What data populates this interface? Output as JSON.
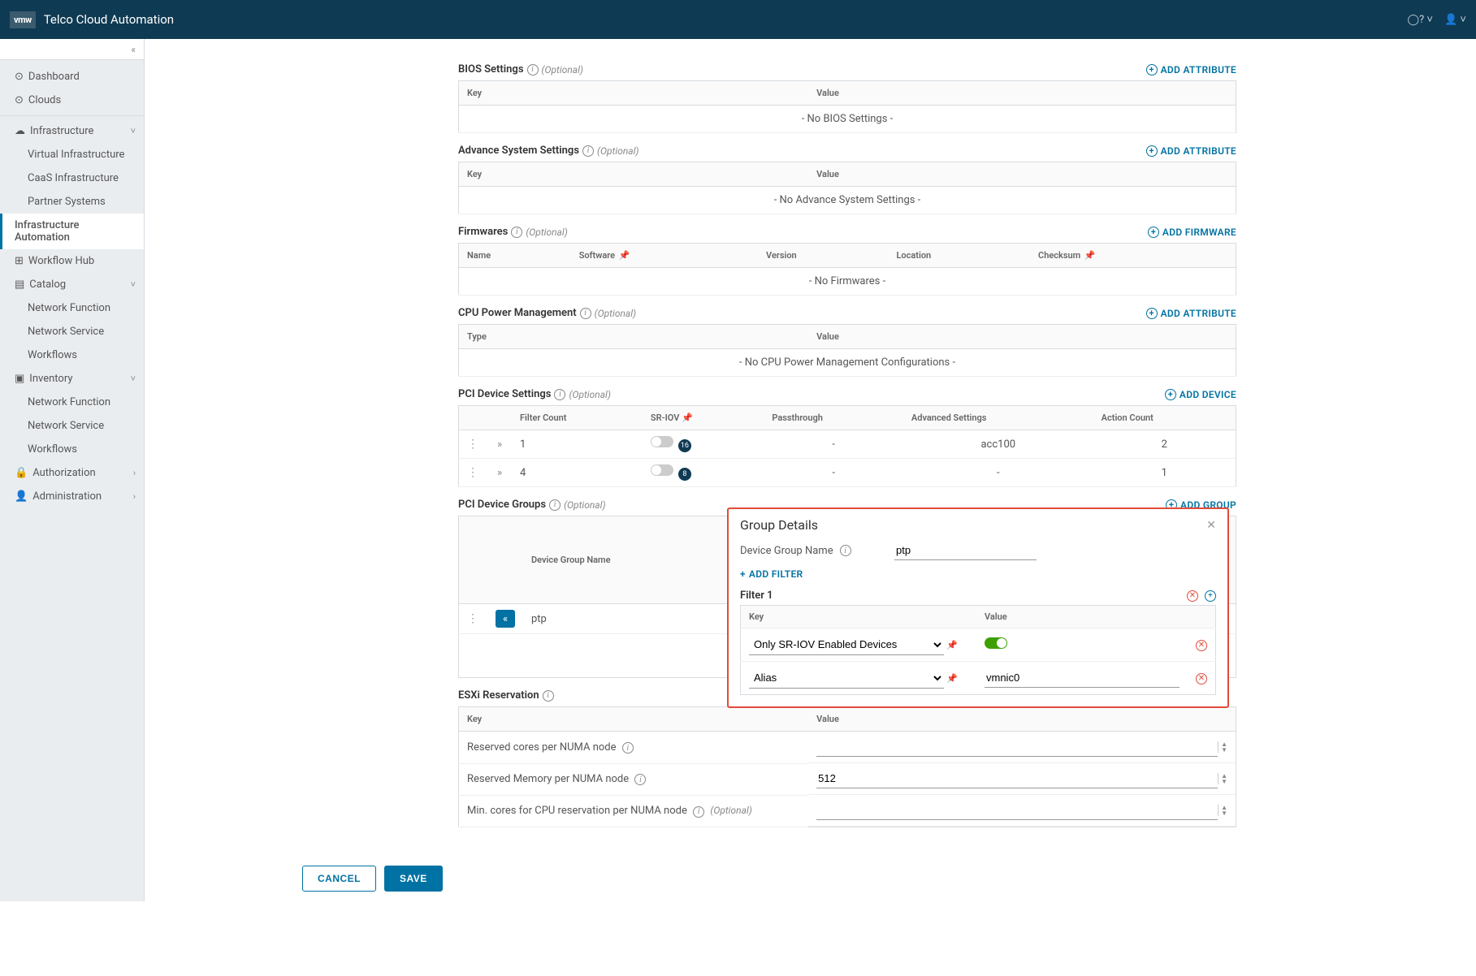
{
  "header": {
    "logo": "vmw",
    "title": "Telco Cloud Automation"
  },
  "sidebar": {
    "dashboard": "Dashboard",
    "clouds": "Clouds",
    "infra": "Infrastructure",
    "infra_items": [
      "Virtual Infrastructure",
      "CaaS Infrastructure",
      "Partner Systems",
      "Infrastructure Automation"
    ],
    "workflow_hub": "Workflow Hub",
    "catalog": "Catalog",
    "catalog_items": [
      "Network Function",
      "Network Service",
      "Workflows"
    ],
    "inventory": "Inventory",
    "inventory_items": [
      "Network Function",
      "Network Service",
      "Workflows"
    ],
    "authorization": "Authorization",
    "administration": "Administration"
  },
  "labels": {
    "optional": "(Optional)",
    "key": "Key",
    "value": "Value",
    "add_attribute": "ADD ATTRIBUTE",
    "add_firmware": "ADD FIRMWARE",
    "add_device": "ADD DEVICE",
    "add_group": "ADD GROUP",
    "add_filter": "ADD FILTER",
    "cancel": "CANCEL",
    "save": "SAVE"
  },
  "bios": {
    "title": "BIOS Settings",
    "empty": "- No BIOS Settings -"
  },
  "advance": {
    "title": "Advance System Settings",
    "empty": "- No Advance System Settings -"
  },
  "firmware": {
    "title": "Firmwares",
    "cols": {
      "name": "Name",
      "software": "Software",
      "version": "Version",
      "location": "Location",
      "checksum": "Checksum"
    },
    "empty": "- No Firmwares -"
  },
  "cpu": {
    "title": "CPU Power Management",
    "cols": {
      "type": "Type"
    },
    "empty": "- No CPU Power Management Configurations -"
  },
  "pci": {
    "title": "PCI Device Settings",
    "cols": {
      "filter": "Filter Count",
      "sriov": "SR-IOV",
      "pass": "Passthrough",
      "adv": "Advanced Settings",
      "action": "Action Count"
    },
    "rows": [
      {
        "filter": "1",
        "badge": "16",
        "pass": "-",
        "adv": "acc100",
        "action": "2"
      },
      {
        "filter": "4",
        "badge": "8",
        "pass": "-",
        "adv": "-",
        "action": "1"
      }
    ]
  },
  "groups": {
    "title": "PCI Device Groups",
    "col_name": "Device Group Name",
    "row_name": "ptp"
  },
  "popover": {
    "title": "Group Details",
    "name_label": "Device Group Name",
    "name_value": "ptp",
    "filter_title": "Filter 1",
    "cols": {
      "key": "Key",
      "value": "Value"
    },
    "rows": [
      {
        "key": "Only SR-IOV Enabled Devices",
        "toggle": true
      },
      {
        "key": "Alias",
        "value": "vmnic0"
      }
    ]
  },
  "esxi": {
    "title": "ESXi Reservation",
    "rows": [
      {
        "label": "Reserved cores per NUMA node",
        "info": true,
        "value": ""
      },
      {
        "label": "Reserved Memory per NUMA node",
        "info": true,
        "value": "512"
      },
      {
        "label": "Min. cores for CPU reservation per NUMA node",
        "info": true,
        "optional": true,
        "value": ""
      }
    ]
  }
}
